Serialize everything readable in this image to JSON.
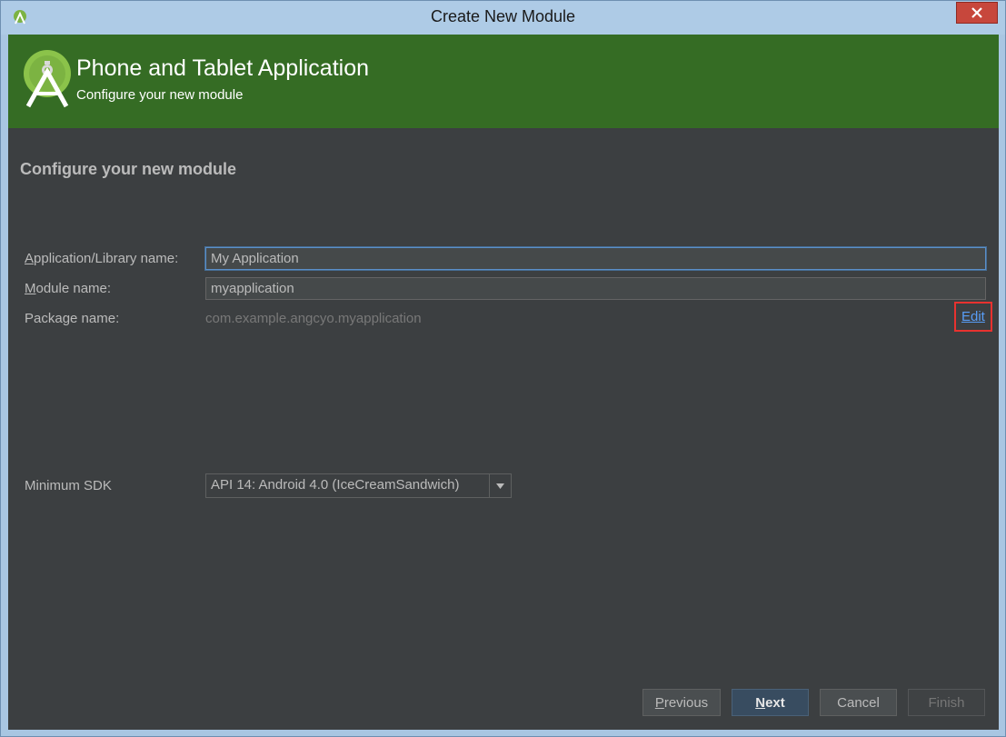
{
  "window": {
    "title": "Create New Module"
  },
  "header": {
    "title": "Phone and Tablet Application",
    "subtitle": "Configure your new module"
  },
  "form": {
    "section_title": "Configure your new module",
    "app_name": {
      "label_prefix": "A",
      "label_rest": "pplication/Library name:",
      "value": "My Application"
    },
    "module_name": {
      "label_prefix": "M",
      "label_rest": "odule name:",
      "value": "myapplication"
    },
    "package_name": {
      "label": "Package name:",
      "value": "com.example.angcyo.myapplication",
      "edit_label": "Edit"
    },
    "min_sdk": {
      "label": "Minimum SDK",
      "value": "API 14: Android 4.0 (IceCreamSandwich)"
    }
  },
  "buttons": {
    "previous_prefix": "P",
    "previous_rest": "revious",
    "next_prefix": "N",
    "next_rest": "ext",
    "cancel": "Cancel",
    "finish": "Finish"
  },
  "colors": {
    "header_bg": "#356c24",
    "content_bg": "#3c3f41",
    "link": "#589df6",
    "highlight": "#e8322f"
  }
}
